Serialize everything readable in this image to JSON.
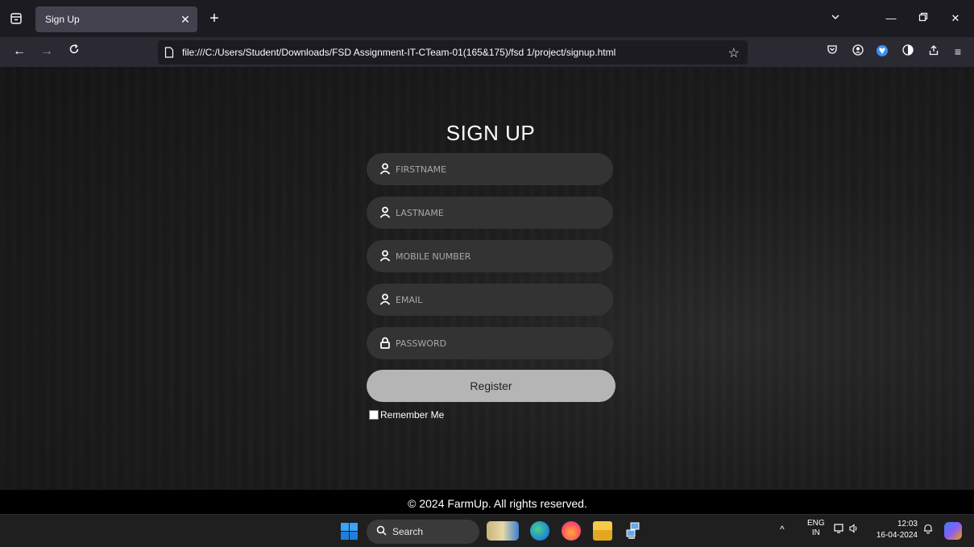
{
  "browser": {
    "tab_title": "Sign Up",
    "url": "file:///C:/Users/Student/Downloads/FSD Assignment-IT-CTeam-01(165&175)/fsd 1/project/signup.html"
  },
  "page": {
    "title": "SIGN UP",
    "fields": [
      {
        "placeholder": "FIRSTNAME",
        "icon": "user-icon"
      },
      {
        "placeholder": "LASTNAME",
        "icon": "user-icon"
      },
      {
        "placeholder": "MOBILE NUMBER",
        "icon": "user-icon"
      },
      {
        "placeholder": "EMAIL",
        "icon": "user-icon"
      },
      {
        "placeholder": "PASSWORD",
        "icon": "lock-icon"
      }
    ],
    "register_label": "Register",
    "remember_label": "Remember Me",
    "footer_text": "© 2024 FarmUp. All rights reserved."
  },
  "taskbar": {
    "search_label": "Search",
    "language_top": "ENG",
    "language_bottom": "IN",
    "time": "12:03",
    "date": "16-04-2024"
  },
  "colors": {
    "page_bg": "#1d1d1d",
    "field_bg": "#333333",
    "button_bg": "#b5b5b5",
    "footer_bg": "#000000"
  }
}
